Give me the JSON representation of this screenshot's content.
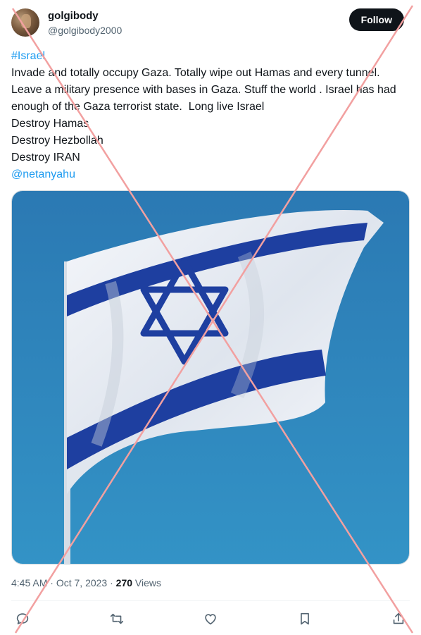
{
  "author": {
    "name": "golgibody",
    "handle": "@golgibody2000",
    "follow_label": "Follow"
  },
  "tweet": {
    "hashtag": "#Israel",
    "body": "Invade and totally occupy Gaza. Totally wipe out Hamas and every tunnel. Leave a military presence with bases in Gaza. Stuff the world . Israel has had enough of the Gaza terrorist state.  Long live Israel",
    "line_1": "Destroy Hamas",
    "line_2": "Destroy Hezbollah",
    "line_3": "Destroy IRAN",
    "mention": "@netanyahu"
  },
  "meta": {
    "time": "4:45 AM",
    "separator_1": " · ",
    "date": "Oct 7, 2023",
    "separator_2": " · ",
    "views_count": "270",
    "views_label": " Views"
  },
  "actions": {
    "icons": [
      "reply-icon",
      "retweet-icon",
      "like-icon",
      "bookmark-icon",
      "share-icon"
    ]
  },
  "colors": {
    "accent_link": "#1d9bf0",
    "follow_bg": "#0f1419",
    "cross_overlay": "#f2a0a0",
    "flag_blue": "#1e3fa0",
    "sky_blue": "#2f86bb"
  }
}
